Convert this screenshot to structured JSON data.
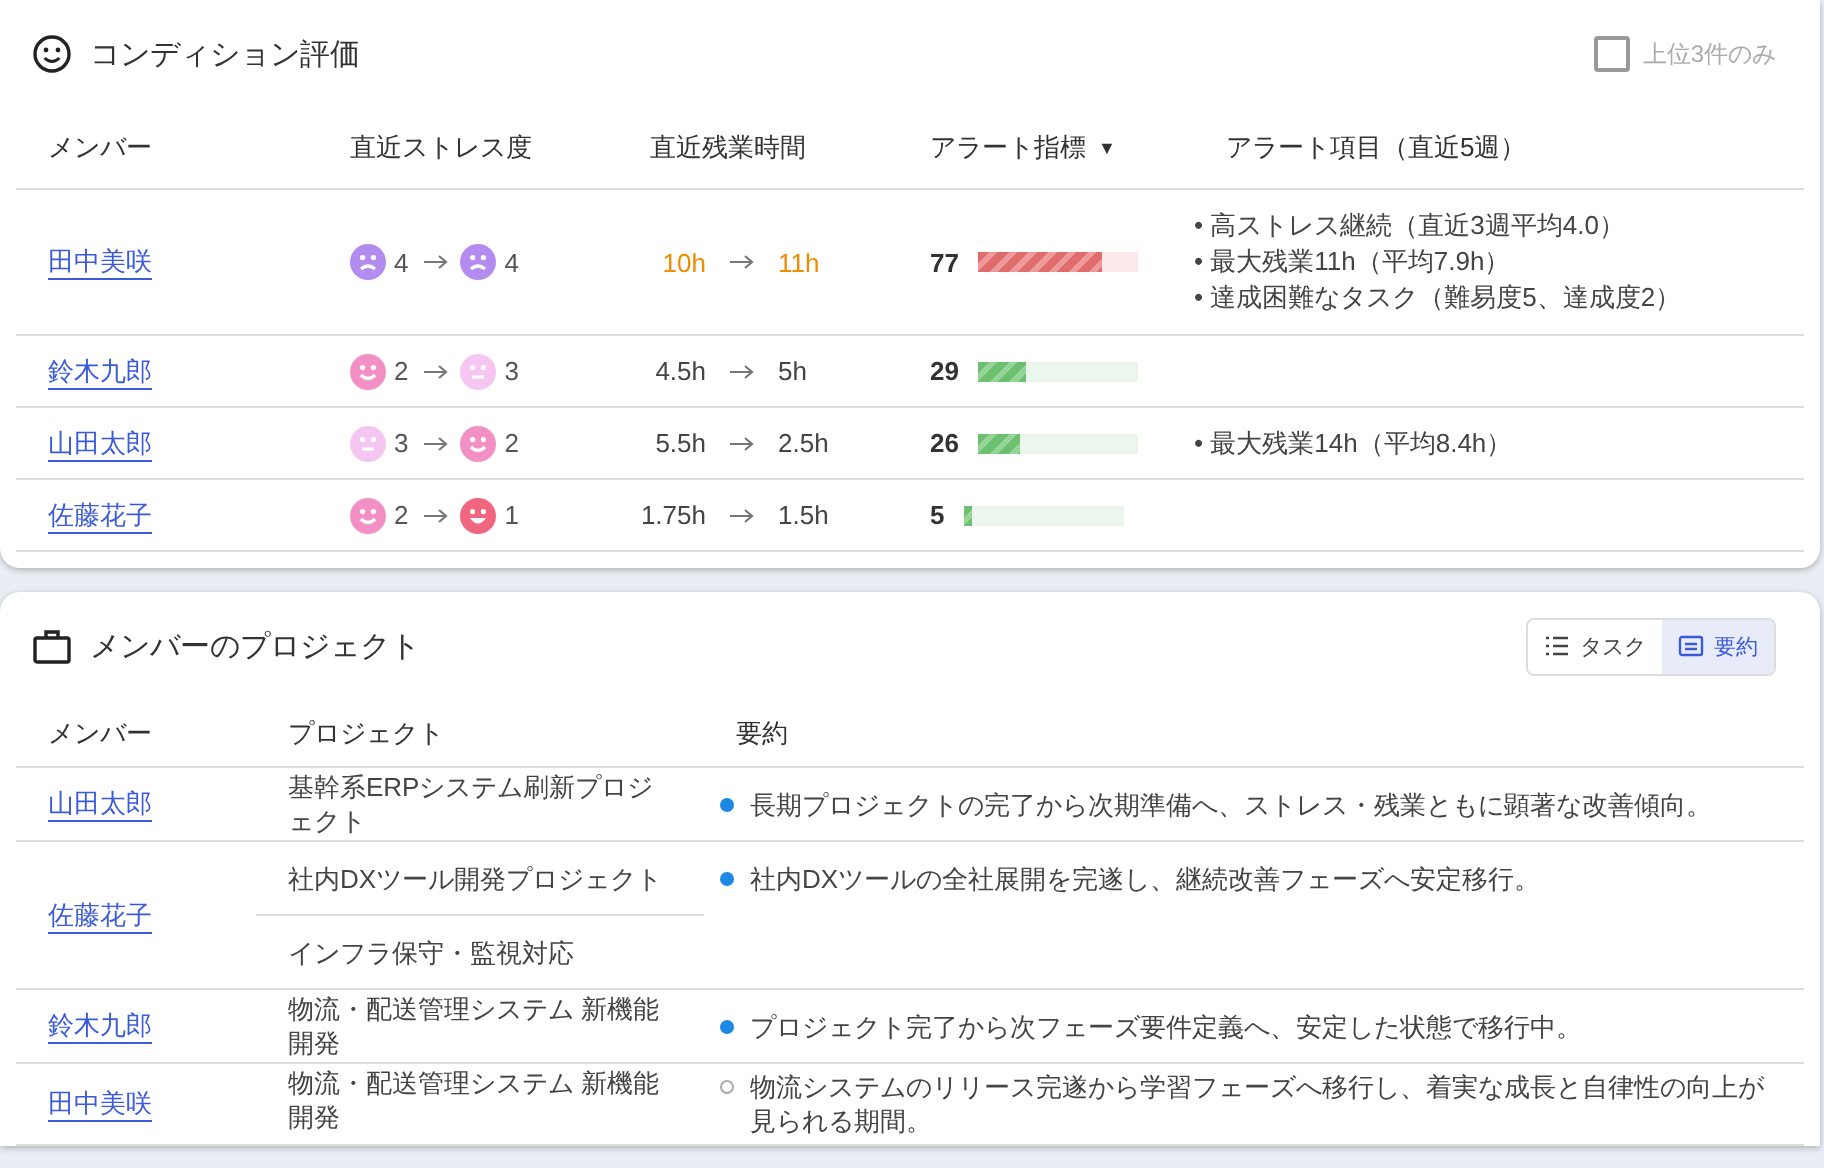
{
  "condition": {
    "title": "コンディション評価",
    "top3_filter": {
      "label": "上位3件のみ",
      "checked": false,
      "disabled": true
    },
    "columns": [
      {
        "label": "メンバー"
      },
      {
        "label": "直近ストレス度"
      },
      {
        "label": "直近残業時間"
      },
      {
        "label": "アラート指標",
        "sort": "▼"
      },
      {
        "label": "アラート項目（直近5週）"
      }
    ],
    "rows": [
      {
        "member": "田中美咲",
        "stress_from": {
          "value": "4",
          "kind": "sad",
          "color": "#b48cf0"
        },
        "stress_to": {
          "value": "4",
          "kind": "sad",
          "color": "#b48cf0"
        },
        "overtime_from": "10h",
        "overtime_to": "11h",
        "overtime_warning": true,
        "alert": {
          "score": "77",
          "kind": "high",
          "level": 0.77
        },
        "alert_items": [
          "• 高ストレス継続（直近3週平均4.0）",
          "• 最大残業11h（平均7.9h）",
          "• 達成困難なタスク（難易度5、達成度2）"
        ]
      },
      {
        "member": "鈴木九郎",
        "stress_from": {
          "value": "2",
          "kind": "smile",
          "color": "#f28fc4"
        },
        "stress_to": {
          "value": "3",
          "kind": "neutral",
          "color": "#f5c6f2"
        },
        "overtime_from": "4.5h",
        "overtime_to": "5h",
        "overtime_warning": false,
        "alert": {
          "score": "29",
          "kind": "normal",
          "level": 0.29
        },
        "alert_items": []
      },
      {
        "member": "山田太郎",
        "stress_from": {
          "value": "3",
          "kind": "neutral",
          "color": "#f5c6f2"
        },
        "stress_to": {
          "value": "2",
          "kind": "smile",
          "color": "#f28fc4"
        },
        "overtime_from": "5.5h",
        "overtime_to": "2.5h",
        "overtime_warning": false,
        "alert": {
          "score": "26",
          "kind": "normal",
          "level": 0.26
        },
        "alert_items": [
          "• 最大残業14h（平均8.4h）"
        ]
      },
      {
        "member": "佐藤花子",
        "stress_from": {
          "value": "2",
          "kind": "smile",
          "color": "#f28fc4"
        },
        "stress_to": {
          "value": "1",
          "kind": "grin",
          "color": "#f0667e"
        },
        "overtime_from": "1.75h",
        "overtime_to": "1.5h",
        "overtime_warning": false,
        "alert": {
          "score": "5",
          "kind": "normal",
          "level": 0.05
        },
        "alert_items": []
      }
    ]
  },
  "projects": {
    "title": "メンバーのプロジェクト",
    "view_toggle": [
      {
        "label": "タスク",
        "kind": "list",
        "selected": false
      },
      {
        "label": "要約",
        "kind": "summary",
        "selected": true
      }
    ],
    "columns": [
      {
        "label": "メンバー"
      },
      {
        "label": "プロジェクト"
      },
      {
        "label": "要約"
      }
    ],
    "rows": [
      {
        "member": "山田太郎",
        "projects": [
          "基幹系ERPシステム刷新プロジェクト"
        ],
        "summary": "長期プロジェクトの完了から次期準備へ、ストレス・残業ともに顕著な改善傾向。",
        "filled": true
      },
      {
        "member": "佐藤花子",
        "projects": [
          "社内DXツール開発プロジェクト",
          "インフラ保守・監視対応"
        ],
        "summary": "社内DXツールの全社展開を完遂し、継続改善フェーズへ安定移行。",
        "filled": true
      },
      {
        "member": "鈴木九郎",
        "projects": [
          "物流・配送管理システム 新機能開発"
        ],
        "summary": "プロジェクト完了から次フェーズ要件定義へ、安定した状態で移行中。",
        "filled": true
      },
      {
        "member": "田中美咲",
        "projects": [
          "物流・配送管理システム 新機能開発"
        ],
        "summary": "物流システムのリリース完遂から学習フェーズへ移行し、着実な成長と自律性の向上が見られる期間。",
        "filled": false
      }
    ]
  }
}
